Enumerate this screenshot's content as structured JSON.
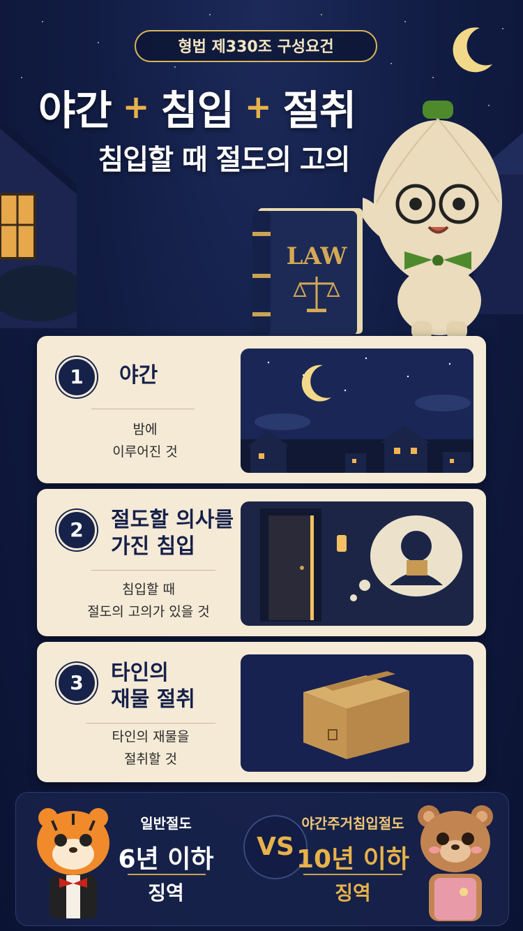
{
  "header": {
    "badge": "형법 제330조 구성요건",
    "title_words": [
      "야간",
      "침입",
      "절취"
    ],
    "title_plus": "+",
    "subtitle": "침입할 때 절도의 고의"
  },
  "book": {
    "label": "LAW"
  },
  "cards": [
    {
      "number": "1",
      "heading_lines": [
        "야간"
      ],
      "desc_lines": [
        "밤에",
        "이루어진 것"
      ]
    },
    {
      "number": "2",
      "heading_lines": [
        "절도할 의사를",
        "가진 침입"
      ],
      "desc_lines": [
        "침입할 때",
        "절도의 고의가 있을 것"
      ]
    },
    {
      "number": "3",
      "heading_lines": [
        "타인의",
        "재물 절취"
      ],
      "desc_lines": [
        "타인의 재물을",
        "절취할 것"
      ]
    }
  ],
  "compare": {
    "left": {
      "label": "일반절도",
      "years": "6년 이하",
      "penalty": "징역"
    },
    "vs": "VS",
    "right": {
      "label": "야간주거침입절도",
      "years": "10년 이하",
      "penalty": "징역"
    }
  },
  "colors": {
    "navy": "#16224a",
    "gold": "#e7b24b",
    "card": "#f5ead6"
  }
}
